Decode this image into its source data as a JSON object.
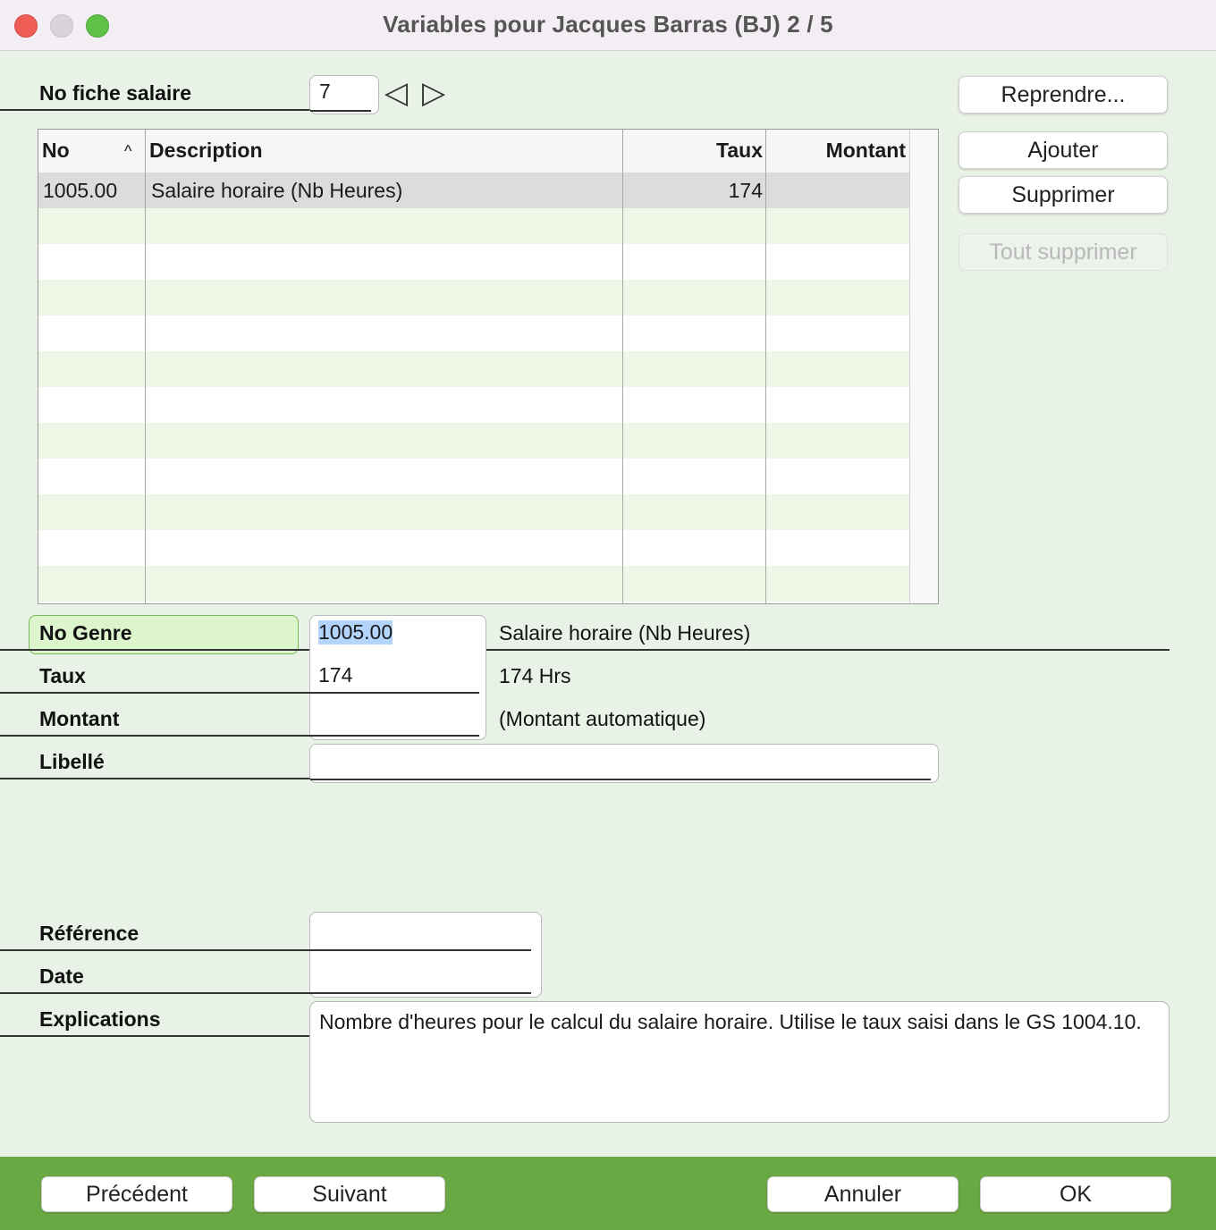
{
  "window": {
    "title": "Variables pour Jacques Barras  (BJ)   2 / 5"
  },
  "fiche": {
    "label": "No fiche salaire",
    "value": "7",
    "prev_icon": "◁",
    "next_icon": "▷"
  },
  "side_buttons": {
    "reprendre": "Reprendre...",
    "ajouter": "Ajouter",
    "supprimer": "Supprimer",
    "tout_supprimer": "Tout supprimer"
  },
  "table": {
    "columns": {
      "no": "No",
      "description": "Description",
      "taux": "Taux",
      "montant": "Montant",
      "sort_icon": "^"
    },
    "rows": [
      {
        "no": "1005.00",
        "description": "Salaire horaire (Nb Heures)",
        "taux": "174",
        "montant": ""
      }
    ]
  },
  "form": {
    "no_genre": {
      "label": "No Genre",
      "value": "1005.00",
      "info": "Salaire horaire (Nb Heures)"
    },
    "taux": {
      "label": "Taux",
      "value": "174",
      "info": "174 Hrs"
    },
    "montant": {
      "label": "Montant",
      "value": "",
      "info": "(Montant automatique)"
    },
    "libelle": {
      "label": "Libellé",
      "value": ""
    },
    "reference": {
      "label": "Référence",
      "value": ""
    },
    "date": {
      "label": "Date",
      "value": ""
    },
    "explications": {
      "label": "Explications",
      "value": "Nombre d'heures pour le calcul du salaire horaire. Utilise le taux saisi dans le GS 1004.10."
    }
  },
  "footer": {
    "precedent": "Précédent",
    "suivant": "Suivant",
    "annuler": "Annuler",
    "ok": "OK"
  },
  "colors": {
    "background": "#e9f2e7",
    "footer": "#6aa844",
    "highlight_label": "#dcf5cc",
    "selection": "#b3d4fb"
  }
}
